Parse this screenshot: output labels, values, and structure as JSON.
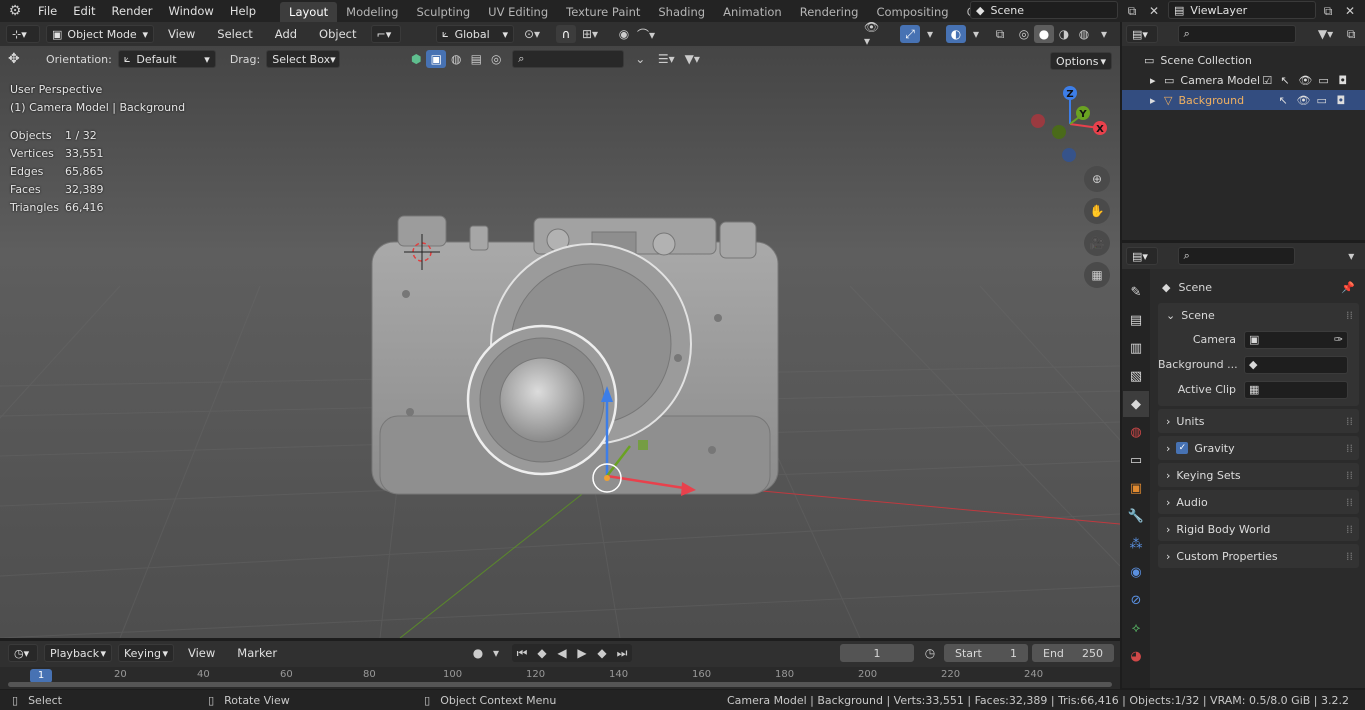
{
  "topbar": {
    "menus": [
      "File",
      "Edit",
      "Render",
      "Window",
      "Help"
    ],
    "workspaces": [
      "Layout",
      "Modeling",
      "Sculpting",
      "UV Editing",
      "Texture Paint",
      "Shading",
      "Animation",
      "Rendering",
      "Compositing",
      "Geometry Noc"
    ],
    "active_workspace": "Layout",
    "scene_name": "Scene",
    "view_layer": "ViewLayer"
  },
  "viewport_header": {
    "mode": "Object Mode",
    "menus": [
      "View",
      "Select",
      "Add",
      "Object"
    ],
    "transform_orientation": "Global",
    "options_label": "Options"
  },
  "tool_header": {
    "orientation_label": "Orientation:",
    "orientation_value": "Default",
    "drag_label": "Drag:",
    "drag_value": "Select Box"
  },
  "viewport": {
    "perspective": "User Perspective",
    "context": "(1) Camera Model | Background",
    "stats": [
      {
        "label": "Objects",
        "value": "1 / 32"
      },
      {
        "label": "Vertices",
        "value": "33,551"
      },
      {
        "label": "Edges",
        "value": "65,865"
      },
      {
        "label": "Faces",
        "value": "32,389"
      },
      {
        "label": "Triangles",
        "value": "66,416"
      }
    ],
    "gizmo_axes": {
      "x": "X",
      "y": "Y",
      "z": "Z"
    },
    "colors": {
      "x_axis": "#e8414c",
      "y_axis": "#6aa222",
      "z_axis": "#3d7ee8"
    }
  },
  "outliner": {
    "root": "Scene Collection",
    "items": [
      {
        "name": "Camera Model",
        "selected": false
      },
      {
        "name": "Background",
        "selected": true
      }
    ]
  },
  "properties": {
    "title": "Scene",
    "scene_panel": {
      "label": "Scene",
      "fields": [
        {
          "label": "Camera"
        },
        {
          "label": "Background ..."
        },
        {
          "label": "Active Clip"
        }
      ]
    },
    "subpanels": [
      "Units",
      "Gravity",
      "Keying Sets",
      "Audio",
      "Rigid Body World",
      "Custom Properties"
    ],
    "gravity_checked": true
  },
  "timeline": {
    "menus": [
      "Playback",
      "Keying",
      "View",
      "Marker"
    ],
    "current_frame": "1",
    "start_label": "Start",
    "start_value": "1",
    "end_label": "End",
    "end_value": "250",
    "ruler": [
      "1",
      "20",
      "40",
      "60",
      "80",
      "100",
      "120",
      "140",
      "160",
      "180",
      "200",
      "220",
      "240"
    ]
  },
  "statusbar": {
    "select": "Select",
    "rotate": "Rotate View",
    "context_menu": "Object Context Menu",
    "info": "Camera Model | Background | Verts:33,551 | Faces:32,389 | Tris:66,416 | Objects:1/32 | VRAM: 0.5/8.0 GiB | 3.2.2"
  }
}
